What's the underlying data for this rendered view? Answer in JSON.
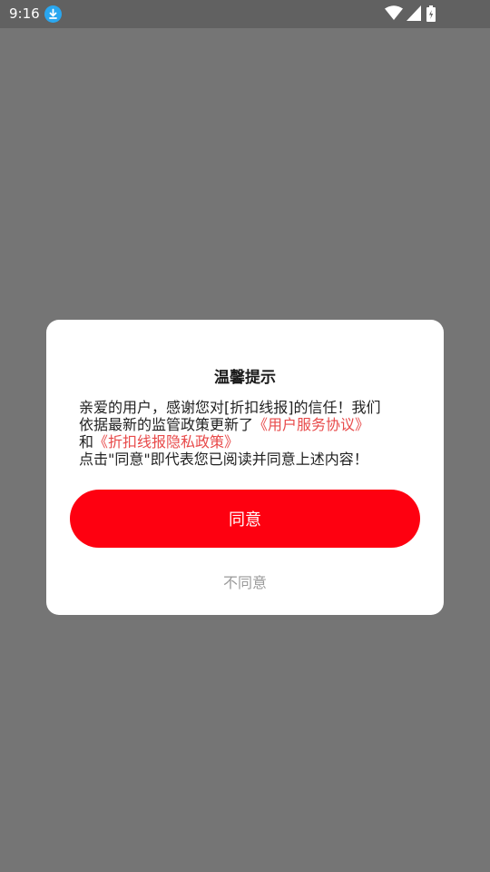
{
  "status_bar": {
    "time": "9:16",
    "icons": [
      "download-icon",
      "wifi-icon",
      "signal-icon",
      "battery-icon"
    ]
  },
  "dialog": {
    "title": "温馨提示",
    "line1": "亲爱的用户，感谢您对[折扣线报]的信任！我们",
    "line2_prefix": "依据最新的监管政策更新了",
    "link_user_agreement": "《用户服务协议》",
    "line3_prefix": "和",
    "link_privacy_policy": "《折扣线报隐私政策》",
    "line4": "点击\"同意\"即代表您已阅读并同意上述内容！",
    "agree_label": "同意",
    "disagree_label": "不同意"
  },
  "colors": {
    "overlay": "#757575",
    "status_bar": "#616161",
    "accent": "#fe0010",
    "link": "#e84a4a",
    "download_badge": "#2aa7f0"
  }
}
